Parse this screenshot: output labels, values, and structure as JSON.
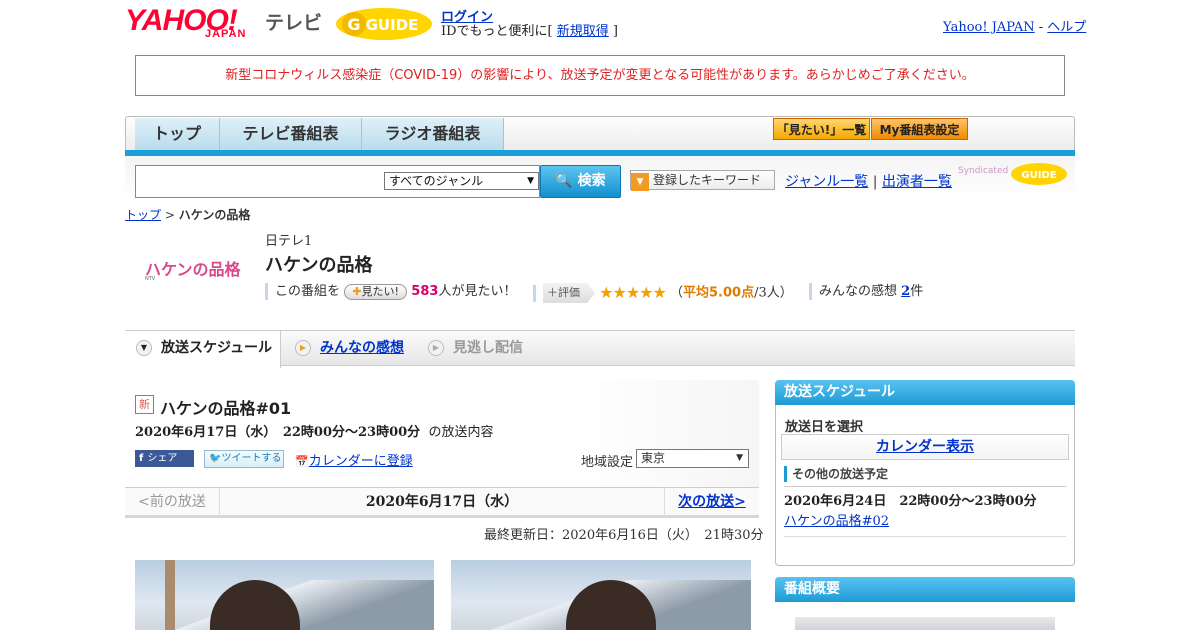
{
  "header": {
    "yahoo_logo": "YAHOO!",
    "yahoo_sub": "JAPAN",
    "tv_label": "テレビ",
    "gguide_logo": "G GUIDE",
    "login": "ログイン",
    "id_text_prefix": "IDでもっと便利に[ ",
    "register": "新規取得",
    "id_text_suffix": " ]",
    "yahoo_japan_link": "Yahoo! JAPAN",
    "separator": " - ",
    "help_link": "ヘルプ"
  },
  "notice": "新型コロナウィルス感染症（COVID-19）の影響により、放送予定が変更となる可能性があります。あらかじめご了承ください。",
  "nav": {
    "tabs": [
      "トップ",
      "テレビ番組表",
      "ラジオ番組表"
    ],
    "mitai_list": "「見たい!」一覧",
    "my_settings": "My番組表設定"
  },
  "search": {
    "input_value": "",
    "genre": "すべてのジャンル",
    "button": "検索",
    "keyword_button": "登録したキーワード",
    "genre_list": "ジャンル一覧",
    "divider": "|",
    "cast_list": "出演者一覧",
    "syndicated": "Syndicated"
  },
  "breadcrumb": {
    "top": "トップ",
    "sep": " > ",
    "current": "ハケンの品格"
  },
  "program": {
    "logo_text": "ハケンの品格",
    "logo_sub": "NTV",
    "channel": "日テレ1",
    "title": "ハケンの品格",
    "mitai_prefix": "この番組を",
    "mitai_button": "見たい!",
    "mitai_count": "583",
    "mitai_suffix": "人が見たい！",
    "hyoka_button": "評価",
    "stars": "★★★★★",
    "rating_open": "（",
    "avg_score": "平均5.00点",
    "rating_people": "/3人）",
    "kansou_prefix": "みんなの感想 ",
    "kansou_count": "2",
    "kansou_suffix": "件"
  },
  "tabs": {
    "schedule": "放送スケジュール",
    "kansou": "みんなの感想",
    "minogashi": "見逃し配信"
  },
  "episode": {
    "badge": "新",
    "title": "ハケンの品格#01",
    "date": "2020年6月17日（水）　22時00分～23時00分",
    "date_suffix": "の放送内容",
    "fb_share": "シェア",
    "tweet": "ツイートする",
    "calendar_register": "カレンダーに登録",
    "region_label": "地域設定",
    "region_value": "東京",
    "prev": "<前の放送",
    "current_date": "2020年6月17日（水）",
    "next": "次の放送>",
    "updated": "最終更新日：2020年6月16日（火）　21時30分"
  },
  "sidebar": {
    "schedule_head": "放送スケジュール",
    "select_day": "放送日を選択",
    "calendar_show": "カレンダー表示",
    "other_schedule": "その他の放送予定",
    "next_date": "2020年6月24日　22時00分～23時00分",
    "next_title": "ハケンの品格#02",
    "overview_head": "番組概要"
  },
  "colors": {
    "accent_blue": "#1a9ed8",
    "yahoo_red": "#ff0033",
    "notice_red": "#e02020",
    "star_orange": "#f2a100"
  }
}
